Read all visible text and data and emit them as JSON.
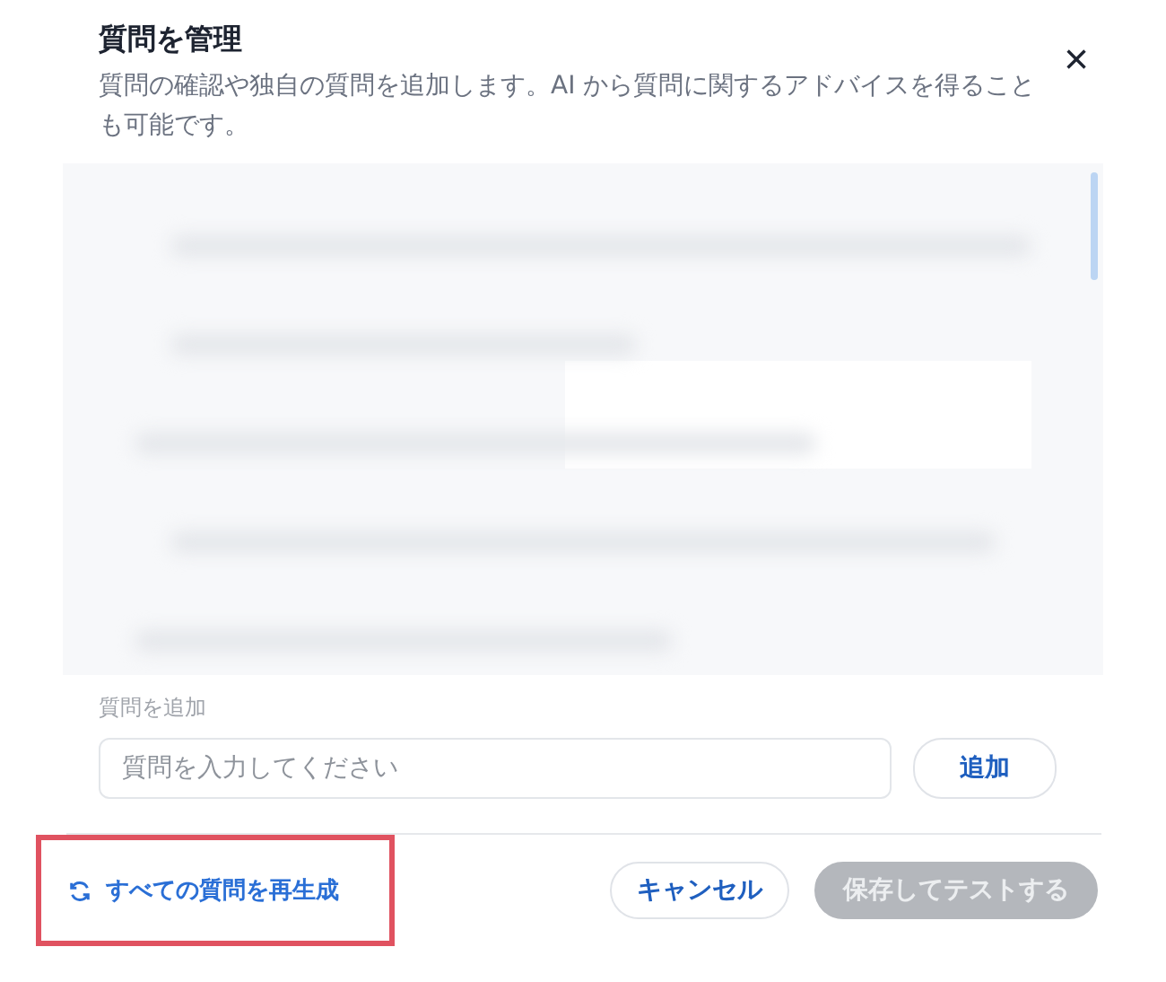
{
  "dialog": {
    "title": "質問を管理",
    "description": "質問の確認や独自の質問を追加します。AI から質問に関するアドバイスを得ることも可能です。",
    "close_icon": "×"
  },
  "add_question": {
    "label": "質問を追加",
    "placeholder": "質問を入力してください",
    "button": "追加"
  },
  "footer": {
    "regenerate": {
      "label": "すべての質問を再生成",
      "highlighted": true
    },
    "buttons": [
      {
        "label": "キャンセル",
        "kind": "secondary",
        "disabled": false
      },
      {
        "label": "保存してテストする",
        "kind": "primary",
        "disabled": true
      }
    ]
  }
}
